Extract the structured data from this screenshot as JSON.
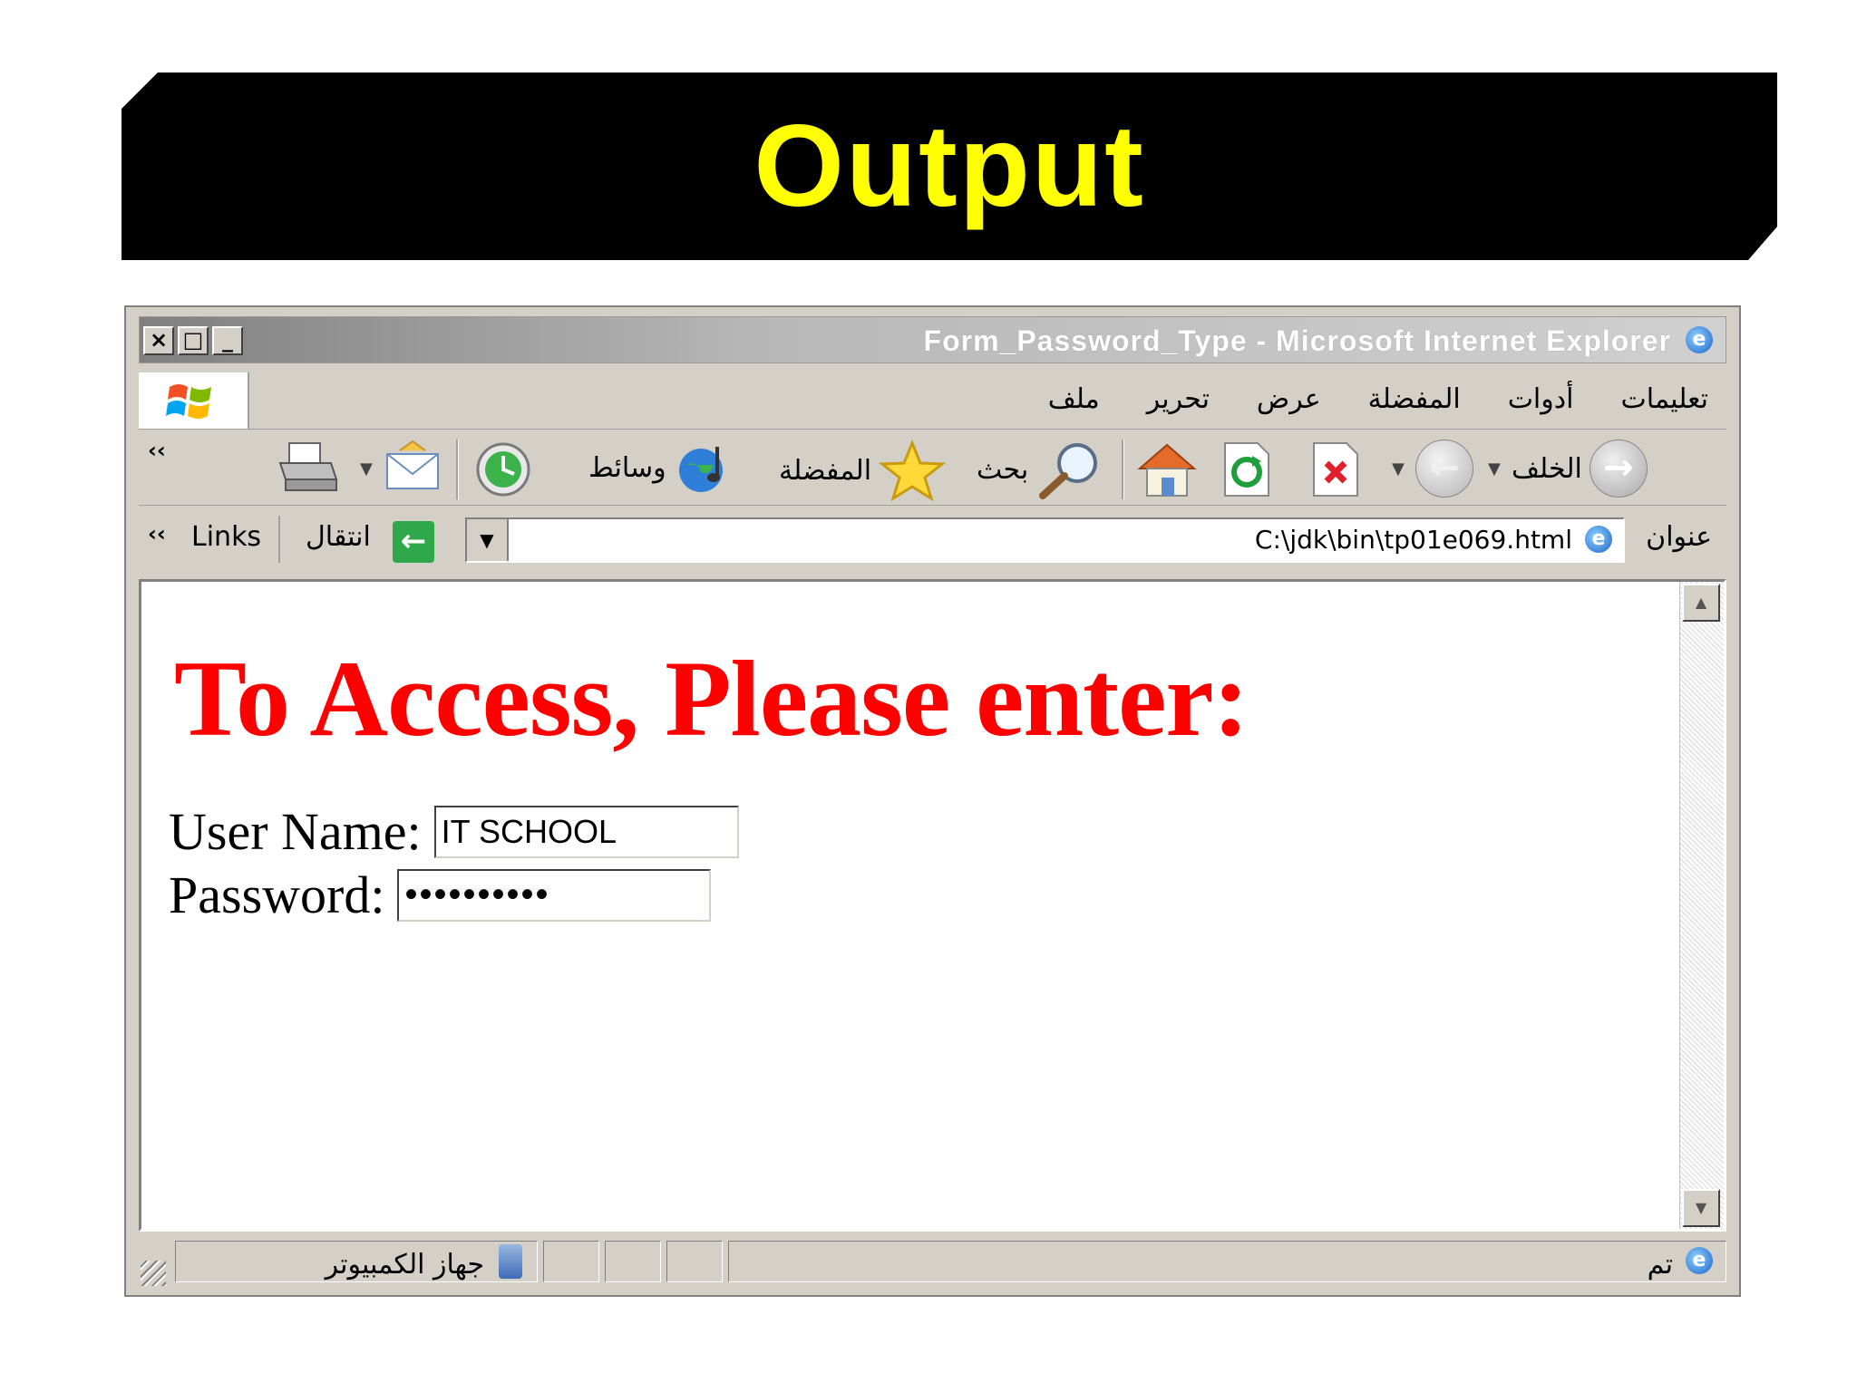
{
  "slide": {
    "title": "Output"
  },
  "window": {
    "title": "Form_Password_Type - Microsoft Internet Explorer",
    "controls": {
      "close": "×",
      "maximize": "□",
      "minimize": "_"
    }
  },
  "menu": {
    "items": [
      "ملف",
      "تحرير",
      "عرض",
      "المفضلة",
      "أدوات",
      "تعليمات"
    ]
  },
  "toolbar": {
    "back_label": "الخلف",
    "search_label": "بحث",
    "favorites_label": "المفضلة",
    "media_label": "وسائط"
  },
  "address": {
    "label": "عنوان",
    "url": "C:\\jdk\\bin\\tp01e069.html",
    "go_label": "انتقال",
    "links_label": "Links"
  },
  "page": {
    "heading": "To Access, Please enter:",
    "username_label": "User Name:",
    "username_value": "IT SCHOOL",
    "password_label": "Password:",
    "password_value": "••••••••••"
  },
  "status": {
    "left_text": "تم",
    "zone_text": "جهاز الكمبيوتر"
  },
  "icons": {
    "close": "close-icon",
    "maximize": "maximize-icon",
    "minimize": "minimize-icon",
    "ie": "ie-icon"
  }
}
